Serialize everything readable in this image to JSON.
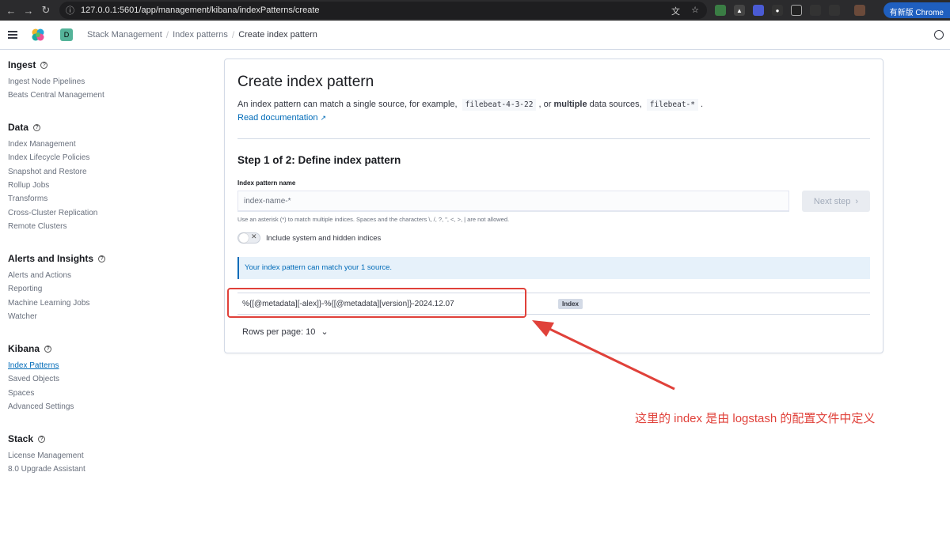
{
  "browser": {
    "url": "127.0.0.1:5601/app/management/kibana/indexPatterns/create",
    "badge_label": "有新版 Chrome",
    "colors": {
      "bar": "#2b2b2d",
      "badge": "#1f5fbf"
    }
  },
  "header": {
    "space_initial": "D",
    "breadcrumbs": [
      "Stack Management",
      "Index patterns",
      "Create index pattern"
    ]
  },
  "sidebar": {
    "groups": [
      {
        "title": "Ingest",
        "items": [
          "Ingest Node Pipelines",
          "Beats Central Management"
        ]
      },
      {
        "title": "Data",
        "items": [
          "Index Management",
          "Index Lifecycle Policies",
          "Snapshot and Restore",
          "Rollup Jobs",
          "Transforms",
          "Cross-Cluster Replication",
          "Remote Clusters"
        ]
      },
      {
        "title": "Alerts and Insights",
        "items": [
          "Alerts and Actions",
          "Reporting",
          "Machine Learning Jobs",
          "Watcher"
        ]
      },
      {
        "title": "Kibana",
        "items": [
          "Index Patterns",
          "Saved Objects",
          "Spaces",
          "Advanced Settings"
        ]
      },
      {
        "title": "Stack",
        "items": [
          "License Management",
          "8.0 Upgrade Assistant"
        ]
      }
    ],
    "active_item": "Index Patterns"
  },
  "main": {
    "title": "Create index pattern",
    "desc_before": "An index pattern can match a single source, for example,",
    "desc_code1": "filebeat-4-3-22",
    "desc_mid": ", or",
    "desc_bold": "multiple",
    "desc_after": "data sources,",
    "desc_code2": "filebeat-*",
    "desc_end": ".",
    "doc_link": "Read documentation",
    "step_title": "Step 1 of 2: Define index pattern",
    "field_label": "Index pattern name",
    "field_placeholder": "index-name-*",
    "field_value": "",
    "next_button": "Next step",
    "helper": "Use an asterisk (*) to match multiple indices. Spaces and the characters \\, /, ?, \", <, >, | are not allowed.",
    "toggle_label": "Include system and hidden indices",
    "toggle_on": false,
    "callout": "Your index pattern can match your 1 source.",
    "rows": [
      {
        "name": "%{[@metadata][-alex]}-%{[@metadata][version]}-2024.12.07",
        "badge": "Index"
      }
    ],
    "rows_per_page": "Rows per page: 10"
  },
  "annotation": {
    "note": "这里的 index 是由 logstash 的配置文件中定义",
    "color": "#e0413a"
  }
}
